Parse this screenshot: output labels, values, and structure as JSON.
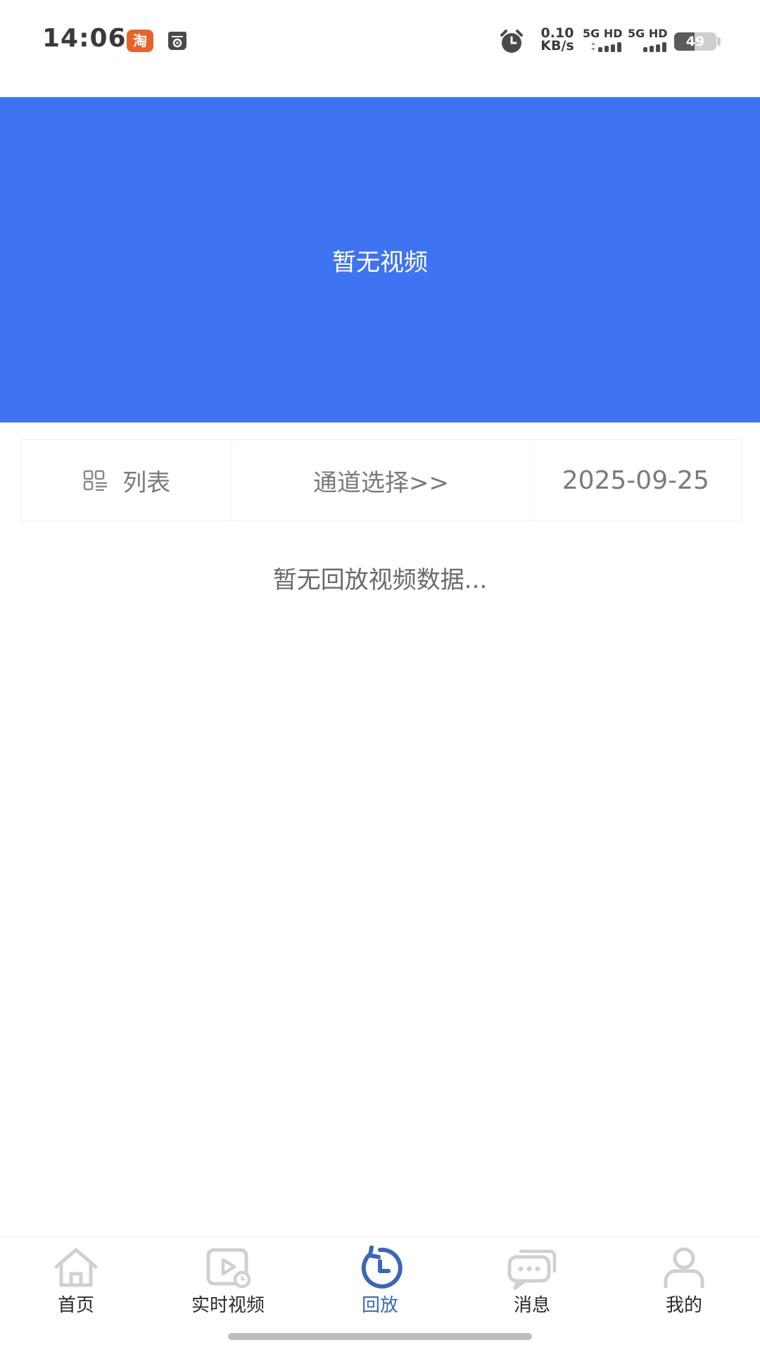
{
  "status_bar": {
    "time": "14:06",
    "app_icon_text": "淘",
    "net_speed_value": "0.10",
    "net_speed_unit": "KB/s",
    "signal1_label": "5G HD",
    "signal2_label": "5G HD",
    "battery_level": "49",
    "battery_fraction": 0.49
  },
  "video": {
    "empty_text": "暂无视频",
    "background_color": "#3e74f2"
  },
  "controls": {
    "list_label": "列表",
    "channel_label": "通道选择>>",
    "date": "2025-09-25"
  },
  "playback": {
    "empty_text": "暂无回放视频数据..."
  },
  "bottom_nav": {
    "active_color": "#3a67b8",
    "items": [
      {
        "label": "首页",
        "icon": "home-icon"
      },
      {
        "label": "实时视频",
        "icon": "live-video-icon"
      },
      {
        "label": "回放",
        "icon": "playback-icon"
      },
      {
        "label": "消息",
        "icon": "message-icon"
      },
      {
        "label": "我的",
        "icon": "profile-icon"
      }
    ]
  }
}
